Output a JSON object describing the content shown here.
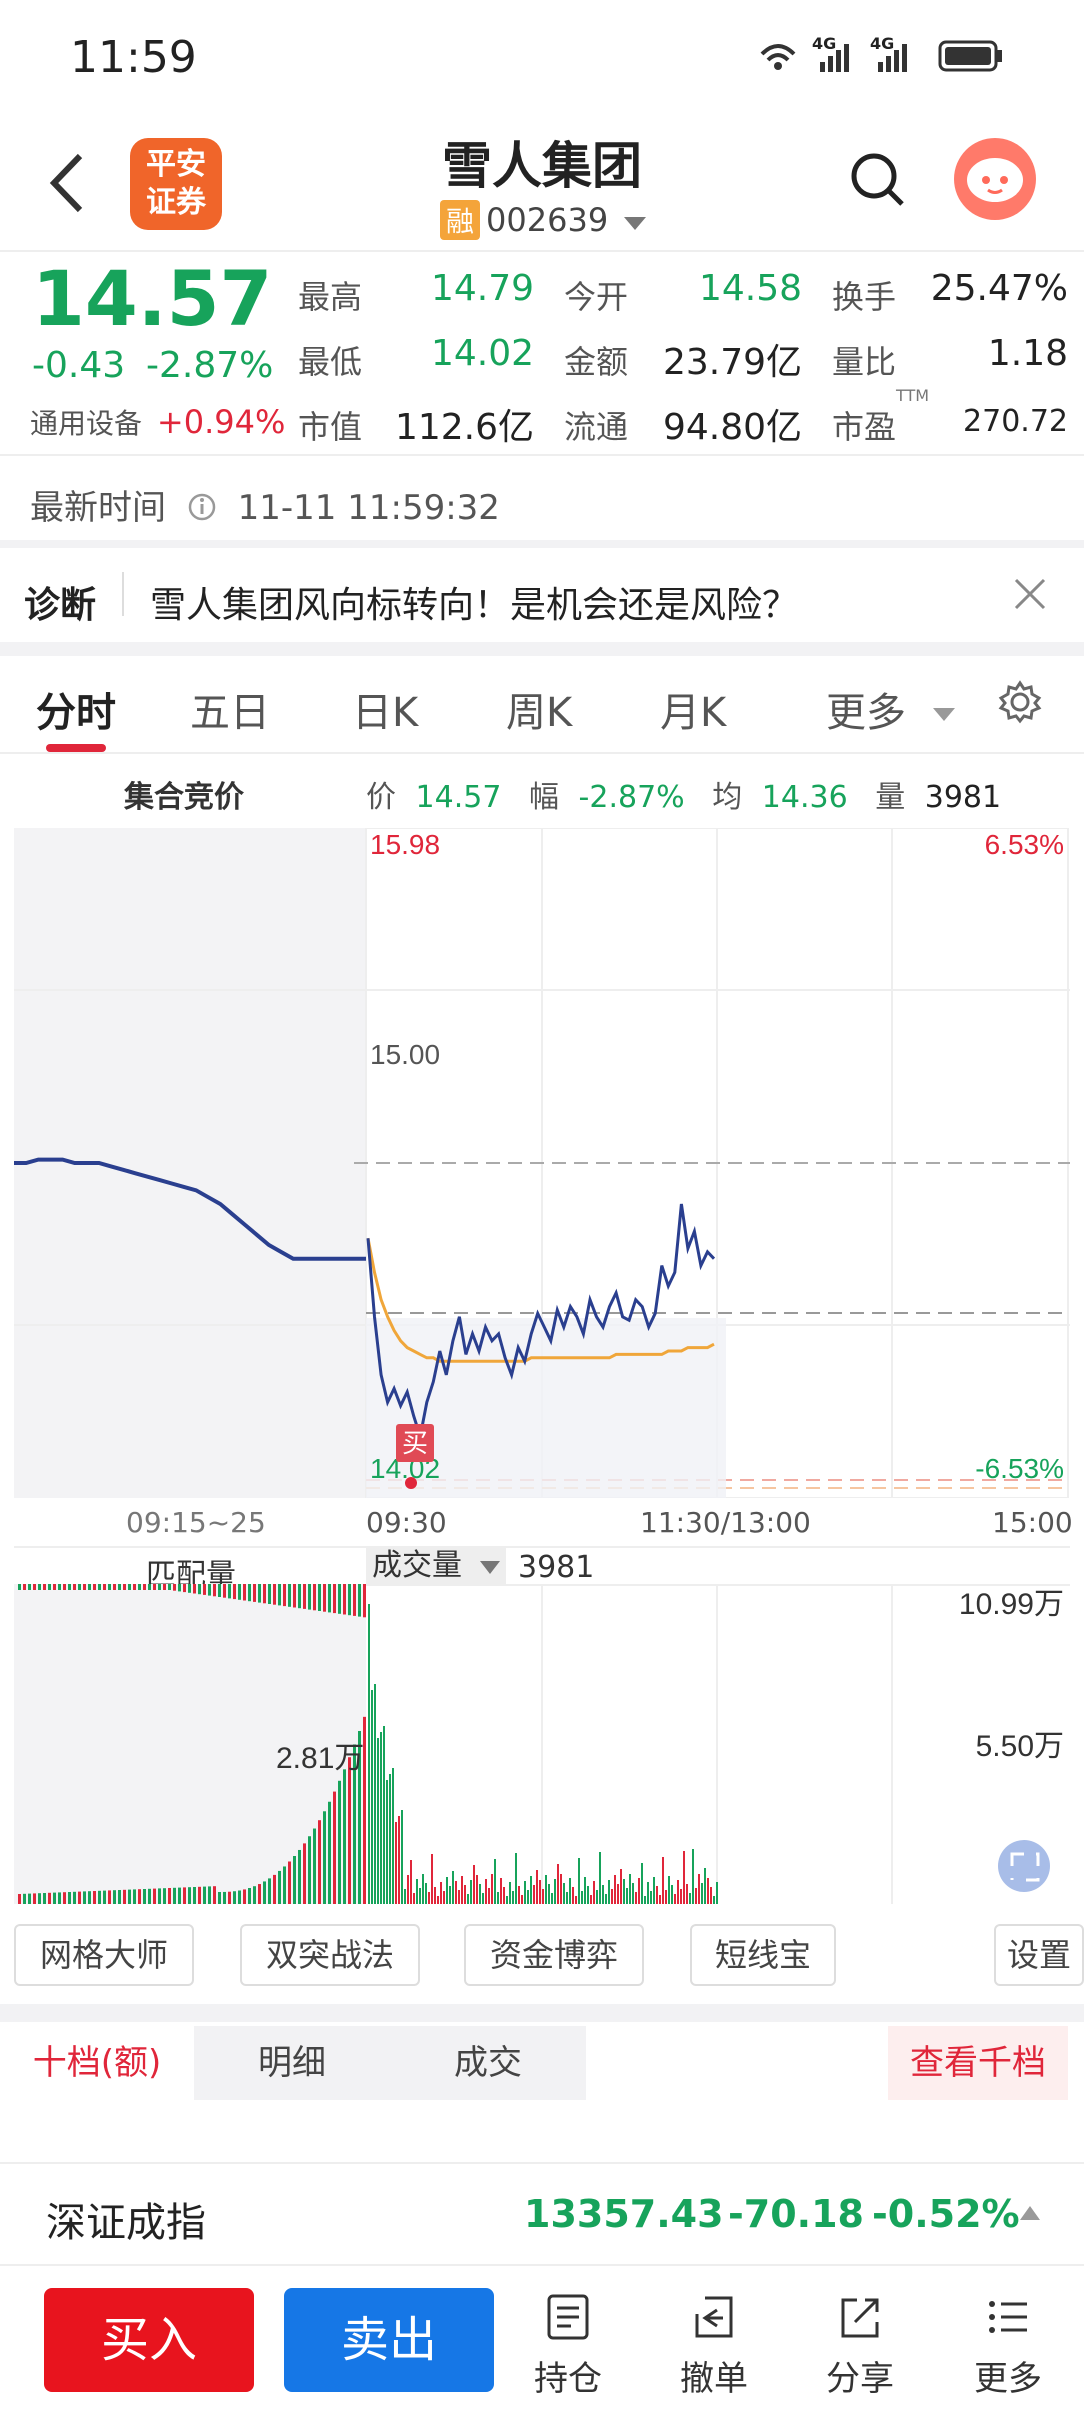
{
  "status_bar": {
    "time": "11:59",
    "network1": "4G",
    "network2": "4G"
  },
  "header": {
    "logo_line1": "平安",
    "logo_line2": "证券",
    "title": "雪人集团",
    "margin_tag": "融",
    "code": "002639"
  },
  "quote": {
    "price": "14.57",
    "change": "-0.43",
    "change_pct": "-2.87%",
    "sector_label": "通用设备",
    "sector_change": "+0.94%",
    "fields": [
      {
        "label": "最高",
        "value": "14.79",
        "color": "green"
      },
      {
        "label": "今开",
        "value": "14.58",
        "color": "green"
      },
      {
        "label": "换手",
        "value": "25.47%",
        "color": "dark"
      },
      {
        "label": "最低",
        "value": "14.02",
        "color": "green"
      },
      {
        "label": "金额",
        "value": "23.79亿",
        "color": "dark"
      },
      {
        "label": "量比",
        "value": "1.18",
        "color": "dark"
      },
      {
        "label": "市值",
        "value": "112.6亿",
        "color": "dark"
      },
      {
        "label": "流通",
        "value": "94.80亿",
        "color": "dark"
      },
      {
        "label": "市盈",
        "value": "270.72",
        "color": "dark",
        "sup": "TTM"
      }
    ]
  },
  "update": {
    "label": "最新时间",
    "time": "11-11 11:59:32"
  },
  "diagnosis": {
    "tag": "诊断",
    "text": "雪人集团风向标转向！是机会还是风险？"
  },
  "chart_tabs": [
    "分时",
    "五日",
    "日K",
    "周K",
    "月K",
    "更多"
  ],
  "info_bar": {
    "auction_label": "集合竞价",
    "price_label": "价",
    "price": "14.57",
    "amp_label": "幅",
    "amp": "-2.87%",
    "avg_label": "均",
    "avg": "14.36",
    "vol_label": "量",
    "vol": "3981"
  },
  "chart_data": {
    "type": "line",
    "price_axis": {
      "max": "15.98",
      "mid": "15.00",
      "min": "14.02",
      "max_pct": "6.53%",
      "min_pct": "-6.53%"
    },
    "x_labels": [
      "09:15~25",
      "09:30",
      "11:30/13:00",
      "15:00"
    ],
    "prev_close": 15.0,
    "ylim": [
      14.02,
      15.98
    ],
    "buy_marker": "买",
    "auction_series": [
      15.0,
      15.0,
      15.01,
      15.01,
      15.01,
      15.0,
      15.0,
      15.0,
      14.99,
      14.98,
      14.97,
      14.96,
      14.95,
      14.94,
      14.93,
      14.92,
      14.9,
      14.88,
      14.85,
      14.82,
      14.79,
      14.76,
      14.74,
      14.72,
      14.72,
      14.72,
      14.72,
      14.72,
      14.72,
      14.72
    ],
    "price_series": [
      14.78,
      14.55,
      14.38,
      14.3,
      14.34,
      14.29,
      14.33,
      14.26,
      14.2,
      14.3,
      14.36,
      14.45,
      14.38,
      14.48,
      14.55,
      14.44,
      14.5,
      14.45,
      14.52,
      14.48,
      14.5,
      14.43,
      14.38,
      14.46,
      14.42,
      14.5,
      14.56,
      14.52,
      14.48,
      14.57,
      14.52,
      14.58,
      14.55,
      14.5,
      14.6,
      14.55,
      14.52,
      14.58,
      14.62,
      14.55,
      14.54,
      14.6,
      14.58,
      14.52,
      14.56,
      14.7,
      14.64,
      14.68,
      14.88,
      14.75,
      14.8,
      14.7,
      14.74,
      14.72
    ],
    "avg_series": [
      14.78,
      14.68,
      14.6,
      14.55,
      14.51,
      14.48,
      14.46,
      14.45,
      14.44,
      14.43,
      14.43,
      14.42,
      14.42,
      14.42,
      14.42,
      14.42,
      14.42,
      14.42,
      14.42,
      14.42,
      14.42,
      14.42,
      14.42,
      14.42,
      14.42,
      14.43,
      14.43,
      14.43,
      14.43,
      14.43,
      14.43,
      14.43,
      14.43,
      14.43,
      14.43,
      14.43,
      14.43,
      14.43,
      14.44,
      14.44,
      14.44,
      14.44,
      14.44,
      14.44,
      14.44,
      14.44,
      14.45,
      14.45,
      14.45,
      14.46,
      14.46,
      14.46,
      14.46,
      14.47
    ]
  },
  "volume": {
    "match_label": "匹配量",
    "vol_label": "成交量",
    "vol_value": "3981",
    "axis_max": "10.99万",
    "axis_mid": "5.50万",
    "peak_label": "2.81万"
  },
  "tools": [
    "网格大师",
    "双突战法",
    "资金博弈",
    "短线宝",
    "设置"
  ],
  "orderbook_tabs": [
    "十档(额)",
    "明细",
    "成交",
    "查看千档"
  ],
  "index": {
    "name": "深证成指",
    "value": "13357.43",
    "change": "-70.18",
    "pct": "-0.52%"
  },
  "bottom": {
    "buy": "买入",
    "sell": "卖出",
    "nav": [
      "持仓",
      "撤单",
      "分享",
      "更多"
    ]
  }
}
